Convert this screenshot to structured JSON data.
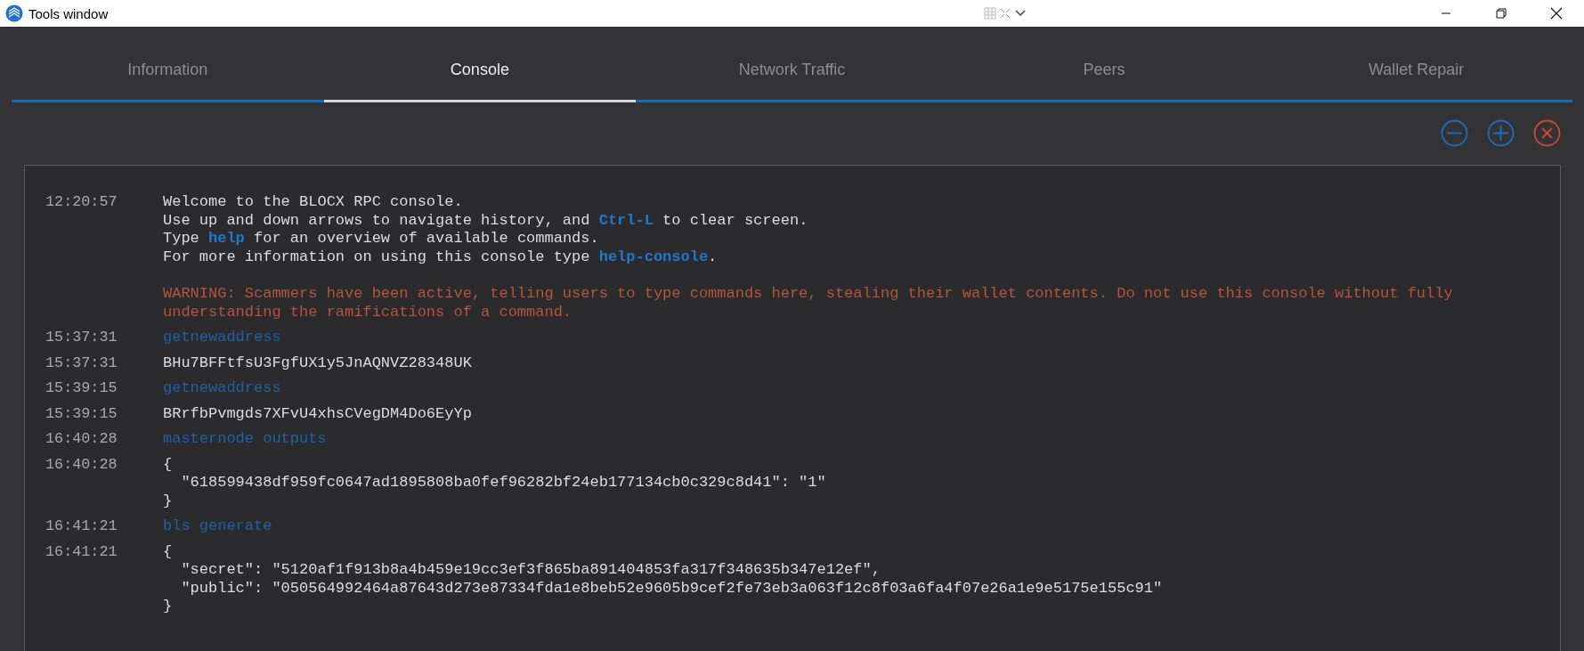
{
  "window": {
    "title": "Tools window"
  },
  "tabs": [
    {
      "label": "Information",
      "selected": false
    },
    {
      "label": "Console",
      "selected": true
    },
    {
      "label": "Network Traffic",
      "selected": false
    },
    {
      "label": "Peers",
      "selected": false
    },
    {
      "label": "Wallet Repair",
      "selected": false
    }
  ],
  "console": {
    "entries": [
      {
        "time": "12:20:57",
        "lines": [
          {
            "kind": "text",
            "text": "Welcome to the BLOCX RPC console."
          },
          {
            "kind": "text",
            "text": "Use up and down arrows to navigate history, and **Ctrl-L** to clear screen."
          },
          {
            "kind": "text",
            "text": "Type **help** for an overview of available commands."
          },
          {
            "kind": "text",
            "text": "For more information on using this console type **help-console**."
          },
          {
            "kind": "warning",
            "text": "WARNING: Scammers have been active, telling users to type commands here, stealing their wallet contents. Do not use this console without fully"
          },
          {
            "kind": "warning",
            "text": "understanding the ramifications of a command."
          }
        ]
      },
      {
        "time": "15:37:31",
        "lines": [
          {
            "kind": "command",
            "text": "getnewaddress"
          }
        ]
      },
      {
        "time": "15:37:31",
        "lines": [
          {
            "kind": "text",
            "text": "BHu7BFFtfsU3FgfUX1y5JnAQNVZ28348UK"
          }
        ]
      },
      {
        "time": "15:39:15",
        "lines": [
          {
            "kind": "command",
            "text": "getnewaddress"
          }
        ]
      },
      {
        "time": "15:39:15",
        "lines": [
          {
            "kind": "text",
            "text": "BRrfbPvmgds7XFvU4xhsCVegDM4Do6EyYp"
          }
        ]
      },
      {
        "time": "16:40:28",
        "lines": [
          {
            "kind": "command",
            "text": "masternode outputs"
          }
        ]
      },
      {
        "time": "16:40:28",
        "lines": [
          {
            "kind": "text",
            "text": "{"
          },
          {
            "kind": "text",
            "text": "  \"618599438df959fc0647ad1895808ba0fef96282bf24eb177134cb0c329c8d41\": \"1\""
          },
          {
            "kind": "text",
            "text": "}"
          }
        ]
      },
      {
        "time": "16:41:21",
        "lines": [
          {
            "kind": "command",
            "text": "bls generate"
          }
        ]
      },
      {
        "time": "16:41:21",
        "lines": [
          {
            "kind": "text",
            "text": "{"
          },
          {
            "kind": "text",
            "text": "  \"secret\": \"5120af1f913b8a4b459e19cc3ef3f865ba891404853fa317f348635b347e12ef\","
          },
          {
            "kind": "text",
            "text": "  \"public\": \"050564992464a87643d273e87334fda1e8beb52e9605b9cef2fe73eb3a063f12c8f03a6fa4f07e26a1e9e5175e155c91\""
          },
          {
            "kind": "text",
            "text": "}"
          }
        ]
      }
    ]
  }
}
